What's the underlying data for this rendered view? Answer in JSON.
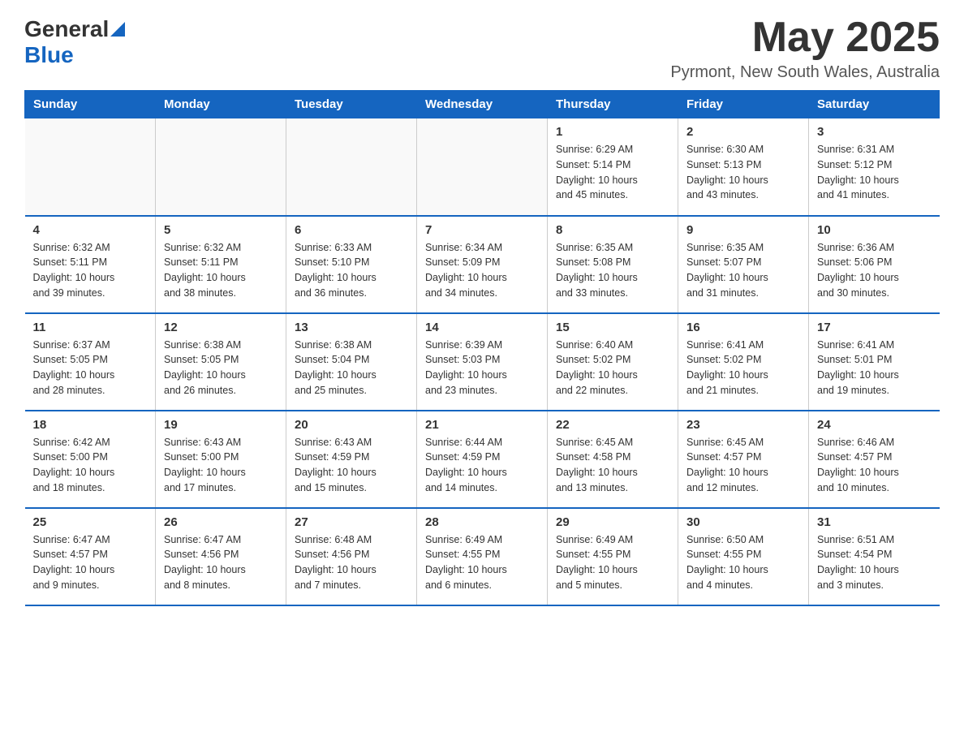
{
  "header": {
    "logo_general": "General",
    "logo_blue": "Blue",
    "month_title": "May 2025",
    "subtitle": "Pyrmont, New South Wales, Australia"
  },
  "days_of_week": [
    "Sunday",
    "Monday",
    "Tuesday",
    "Wednesday",
    "Thursday",
    "Friday",
    "Saturday"
  ],
  "weeks": [
    [
      {
        "day": "",
        "info": ""
      },
      {
        "day": "",
        "info": ""
      },
      {
        "day": "",
        "info": ""
      },
      {
        "day": "",
        "info": ""
      },
      {
        "day": "1",
        "info": "Sunrise: 6:29 AM\nSunset: 5:14 PM\nDaylight: 10 hours\nand 45 minutes."
      },
      {
        "day": "2",
        "info": "Sunrise: 6:30 AM\nSunset: 5:13 PM\nDaylight: 10 hours\nand 43 minutes."
      },
      {
        "day": "3",
        "info": "Sunrise: 6:31 AM\nSunset: 5:12 PM\nDaylight: 10 hours\nand 41 minutes."
      }
    ],
    [
      {
        "day": "4",
        "info": "Sunrise: 6:32 AM\nSunset: 5:11 PM\nDaylight: 10 hours\nand 39 minutes."
      },
      {
        "day": "5",
        "info": "Sunrise: 6:32 AM\nSunset: 5:11 PM\nDaylight: 10 hours\nand 38 minutes."
      },
      {
        "day": "6",
        "info": "Sunrise: 6:33 AM\nSunset: 5:10 PM\nDaylight: 10 hours\nand 36 minutes."
      },
      {
        "day": "7",
        "info": "Sunrise: 6:34 AM\nSunset: 5:09 PM\nDaylight: 10 hours\nand 34 minutes."
      },
      {
        "day": "8",
        "info": "Sunrise: 6:35 AM\nSunset: 5:08 PM\nDaylight: 10 hours\nand 33 minutes."
      },
      {
        "day": "9",
        "info": "Sunrise: 6:35 AM\nSunset: 5:07 PM\nDaylight: 10 hours\nand 31 minutes."
      },
      {
        "day": "10",
        "info": "Sunrise: 6:36 AM\nSunset: 5:06 PM\nDaylight: 10 hours\nand 30 minutes."
      }
    ],
    [
      {
        "day": "11",
        "info": "Sunrise: 6:37 AM\nSunset: 5:05 PM\nDaylight: 10 hours\nand 28 minutes."
      },
      {
        "day": "12",
        "info": "Sunrise: 6:38 AM\nSunset: 5:05 PM\nDaylight: 10 hours\nand 26 minutes."
      },
      {
        "day": "13",
        "info": "Sunrise: 6:38 AM\nSunset: 5:04 PM\nDaylight: 10 hours\nand 25 minutes."
      },
      {
        "day": "14",
        "info": "Sunrise: 6:39 AM\nSunset: 5:03 PM\nDaylight: 10 hours\nand 23 minutes."
      },
      {
        "day": "15",
        "info": "Sunrise: 6:40 AM\nSunset: 5:02 PM\nDaylight: 10 hours\nand 22 minutes."
      },
      {
        "day": "16",
        "info": "Sunrise: 6:41 AM\nSunset: 5:02 PM\nDaylight: 10 hours\nand 21 minutes."
      },
      {
        "day": "17",
        "info": "Sunrise: 6:41 AM\nSunset: 5:01 PM\nDaylight: 10 hours\nand 19 minutes."
      }
    ],
    [
      {
        "day": "18",
        "info": "Sunrise: 6:42 AM\nSunset: 5:00 PM\nDaylight: 10 hours\nand 18 minutes."
      },
      {
        "day": "19",
        "info": "Sunrise: 6:43 AM\nSunset: 5:00 PM\nDaylight: 10 hours\nand 17 minutes."
      },
      {
        "day": "20",
        "info": "Sunrise: 6:43 AM\nSunset: 4:59 PM\nDaylight: 10 hours\nand 15 minutes."
      },
      {
        "day": "21",
        "info": "Sunrise: 6:44 AM\nSunset: 4:59 PM\nDaylight: 10 hours\nand 14 minutes."
      },
      {
        "day": "22",
        "info": "Sunrise: 6:45 AM\nSunset: 4:58 PM\nDaylight: 10 hours\nand 13 minutes."
      },
      {
        "day": "23",
        "info": "Sunrise: 6:45 AM\nSunset: 4:57 PM\nDaylight: 10 hours\nand 12 minutes."
      },
      {
        "day": "24",
        "info": "Sunrise: 6:46 AM\nSunset: 4:57 PM\nDaylight: 10 hours\nand 10 minutes."
      }
    ],
    [
      {
        "day": "25",
        "info": "Sunrise: 6:47 AM\nSunset: 4:57 PM\nDaylight: 10 hours\nand 9 minutes."
      },
      {
        "day": "26",
        "info": "Sunrise: 6:47 AM\nSunset: 4:56 PM\nDaylight: 10 hours\nand 8 minutes."
      },
      {
        "day": "27",
        "info": "Sunrise: 6:48 AM\nSunset: 4:56 PM\nDaylight: 10 hours\nand 7 minutes."
      },
      {
        "day": "28",
        "info": "Sunrise: 6:49 AM\nSunset: 4:55 PM\nDaylight: 10 hours\nand 6 minutes."
      },
      {
        "day": "29",
        "info": "Sunrise: 6:49 AM\nSunset: 4:55 PM\nDaylight: 10 hours\nand 5 minutes."
      },
      {
        "day": "30",
        "info": "Sunrise: 6:50 AM\nSunset: 4:55 PM\nDaylight: 10 hours\nand 4 minutes."
      },
      {
        "day": "31",
        "info": "Sunrise: 6:51 AM\nSunset: 4:54 PM\nDaylight: 10 hours\nand 3 minutes."
      }
    ]
  ]
}
